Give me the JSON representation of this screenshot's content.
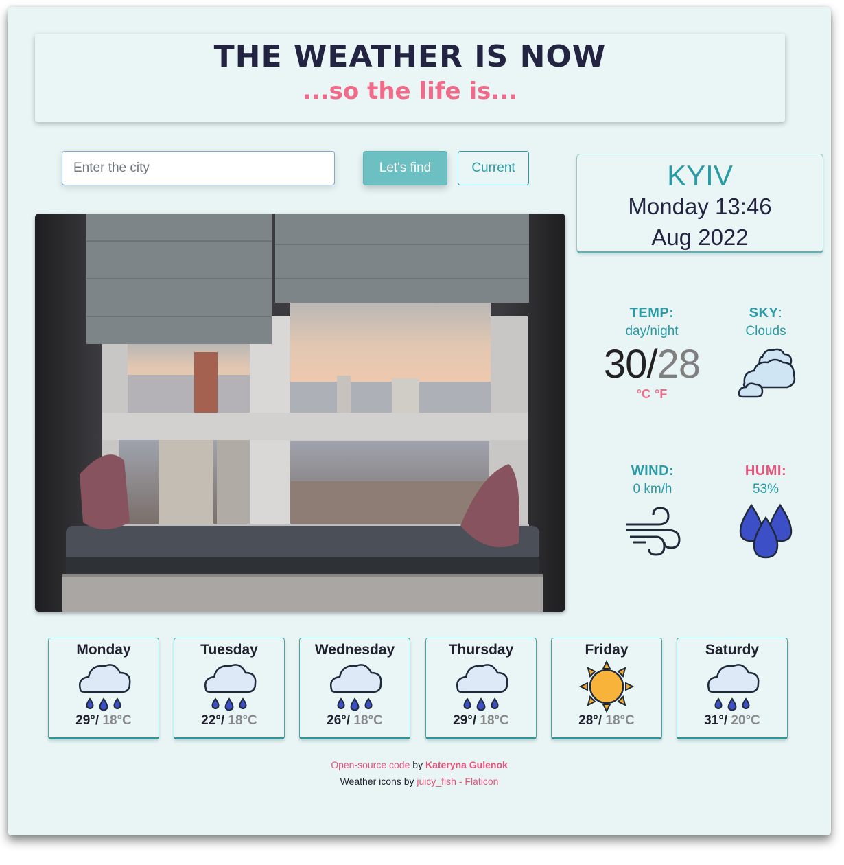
{
  "header": {
    "title": "THE WEATHER IS NOW",
    "subtitle": "...so the life is..."
  },
  "search": {
    "placeholder": "Enter the city",
    "find_label": "Let's find",
    "current_label": "Current"
  },
  "location": {
    "city": "KYIV",
    "day_time": "Monday 13:46",
    "month_year": "Aug 2022"
  },
  "stats": {
    "temp": {
      "label": "TEMP:",
      "sub": "day/night",
      "day": "30",
      "sep": "/",
      "night": "28",
      "unit_c": "°C",
      "unit_f": "°F"
    },
    "sky": {
      "label": "SKY",
      "colon": ":",
      "value": "Clouds",
      "icon": "cloud-icon"
    },
    "wind": {
      "label": "WIND:",
      "value": "0 km/h",
      "icon": "wind-icon"
    },
    "humi": {
      "label": "HUMI:",
      "value": "53%",
      "icon": "drops-icon"
    }
  },
  "forecast": [
    {
      "day": "Monday",
      "max": "29°/",
      "min": " 18°C",
      "icon": "rain-cloud-icon"
    },
    {
      "day": "Tuesday",
      "max": "22°/",
      "min": " 18°C",
      "icon": "rain-cloud-icon"
    },
    {
      "day": "Wednesday",
      "max": "26°/",
      "min": " 18°C",
      "icon": "rain-cloud-icon"
    },
    {
      "day": "Thursday",
      "max": "29°/",
      "min": " 18°C",
      "icon": "rain-cloud-icon"
    },
    {
      "day": "Friday",
      "max": "28°/",
      "min": " 18°C",
      "icon": "sun-icon"
    },
    {
      "day": "Saturdy",
      "max": "31°/",
      "min": " 20°C",
      "icon": "rain-cloud-icon"
    }
  ],
  "footer": {
    "code_link": "Open-source code",
    "by1": " by ",
    "author": "Kateryna Gulenok",
    "icons_text": "Weather icons by ",
    "icons_link": "juicy_fish - Flaticon"
  },
  "colors": {
    "background": "#e9f5f5",
    "accent": "#2a9ba5",
    "pink": "#f06a8a",
    "navy": "#232342"
  }
}
